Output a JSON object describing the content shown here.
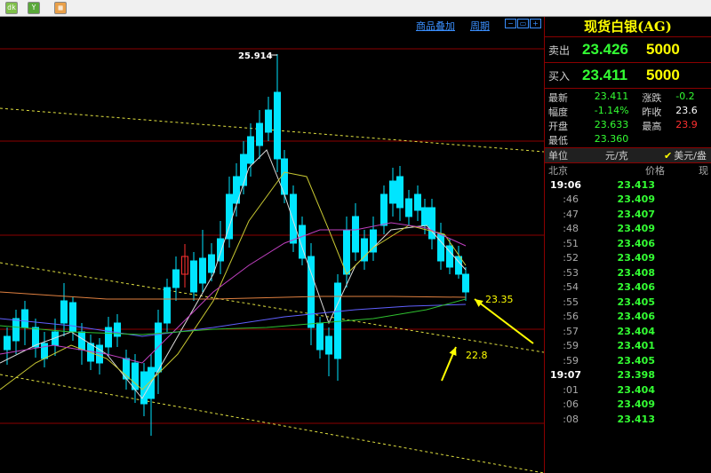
{
  "toolbar": {
    "buttons": [
      {
        "icon": "kline-icon",
        "glyph": "dk"
      },
      {
        "icon": "filter-icon",
        "glyph": "Y"
      },
      {
        "icon": "calendar-icon",
        "glyph": "▦"
      }
    ]
  },
  "chart_menu": {
    "overlay_label": "商品叠加",
    "period_label": "周期"
  },
  "chart_labels": {
    "high_price": "25.914",
    "annotation_1": "23.35",
    "annotation_2": "22.8"
  },
  "panel": {
    "title": "现货白银(AG)",
    "sell": {
      "label": "卖出",
      "price": "23.426",
      "volume": "5000"
    },
    "buy": {
      "label": "买入",
      "price": "23.411",
      "volume": "5000"
    },
    "stats": [
      {
        "k1": "最新",
        "v1": "23.411",
        "k2": "涨跌",
        "v2": "-0.2"
      },
      {
        "k1": "幅度",
        "v1": "-1.14%",
        "k2": "昨收",
        "v2": "23.6"
      },
      {
        "k1": "开盘",
        "v1": "23.633",
        "k2": "最高",
        "v2": "23.9"
      },
      {
        "k1": "最低",
        "v1": "23.360",
        "k2": "",
        "v2": ""
      }
    ],
    "unit": {
      "label": "单位",
      "value": "元/克",
      "alt": "美元/盎"
    },
    "ticks_header": {
      "place": "北京",
      "price": "价格",
      "extra": "现"
    },
    "ticks": [
      {
        "time": "19:06",
        "price": "23.413",
        "major": true
      },
      {
        "time": ":46",
        "price": "23.409",
        "major": false
      },
      {
        "time": ":47",
        "price": "23.407",
        "major": false
      },
      {
        "time": ":48",
        "price": "23.409",
        "major": false
      },
      {
        "time": ":51",
        "price": "23.406",
        "major": false
      },
      {
        "time": ":52",
        "price": "23.409",
        "major": false
      },
      {
        "time": ":53",
        "price": "23.408",
        "major": false
      },
      {
        "time": ":54",
        "price": "23.406",
        "major": false
      },
      {
        "time": ":55",
        "price": "23.405",
        "major": false
      },
      {
        "time": ":56",
        "price": "23.406",
        "major": false
      },
      {
        "time": ":57",
        "price": "23.404",
        "major": false
      },
      {
        "time": ":59",
        "price": "23.401",
        "major": false
      },
      {
        "time": ":59",
        "price": "23.405",
        "major": false
      },
      {
        "time": "19:07",
        "price": "23.398",
        "major": true
      },
      {
        "time": ":01",
        "price": "23.404",
        "major": false
      },
      {
        "time": ":06",
        "price": "23.409",
        "major": false
      },
      {
        "time": ":08",
        "price": "23.413",
        "major": false
      }
    ]
  },
  "colors": {
    "up": "#ff3030",
    "down": "#00e5ff",
    "grid": "#8b0000",
    "ma_white": "#dddddd",
    "ma_yellow": "#c8c832",
    "ma_purple": "#c040c0",
    "ma_green": "#30c030",
    "ma_blue": "#6060ff",
    "ma_orange": "#e08040",
    "trend": "#e0e040"
  }
}
